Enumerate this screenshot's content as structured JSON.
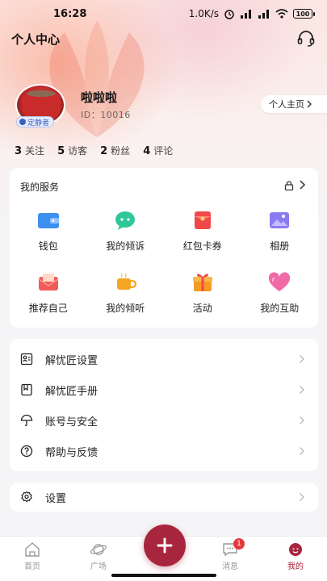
{
  "status_bar": {
    "time": "16:28",
    "network_speed": "1.0K/s",
    "battery": "100"
  },
  "header": {
    "title": "个人中心",
    "support_icon": "headset-icon"
  },
  "profile": {
    "nickname": "啦啦啦",
    "user_id": "ID：10016",
    "badge": "定静者",
    "home_button": "个人主页"
  },
  "stats": [
    {
      "num": "3",
      "label": "关注"
    },
    {
      "num": "5",
      "label": "访客"
    },
    {
      "num": "2",
      "label": "粉丝"
    },
    {
      "num": "4",
      "label": "评论"
    }
  ],
  "services": {
    "title": "我的服务",
    "items": [
      {
        "label": "钱包",
        "icon": "wallet-icon"
      },
      {
        "label": "我的倾诉",
        "icon": "chat-bubble-icon"
      },
      {
        "label": "红包卡券",
        "icon": "red-envelope-icon"
      },
      {
        "label": "相册",
        "icon": "photo-album-icon"
      },
      {
        "label": "推荐自己",
        "icon": "envelope-icon"
      },
      {
        "label": "我的倾听",
        "icon": "tea-cup-icon"
      },
      {
        "label": "活动",
        "icon": "gift-icon"
      },
      {
        "label": "我的互助",
        "icon": "heart-icon"
      }
    ]
  },
  "menu": [
    {
      "label": "解忧匠设置",
      "icon": "id-card-icon"
    },
    {
      "label": "解忧匠手册",
      "icon": "handbook-icon"
    },
    {
      "label": "账号与安全",
      "icon": "umbrella-icon"
    },
    {
      "label": "帮助与反馈",
      "icon": "help-icon"
    }
  ],
  "settings": {
    "label": "设置",
    "icon": "gear-icon"
  },
  "tabs": [
    {
      "label": "首页",
      "icon": "home-icon"
    },
    {
      "label": "广场",
      "icon": "planet-icon"
    },
    {
      "label": "消息",
      "icon": "message-icon",
      "badge": "1"
    },
    {
      "label": "我的",
      "icon": "profile-icon"
    }
  ],
  "colors": {
    "accent": "#a8263d",
    "badge": "#e5383b"
  }
}
